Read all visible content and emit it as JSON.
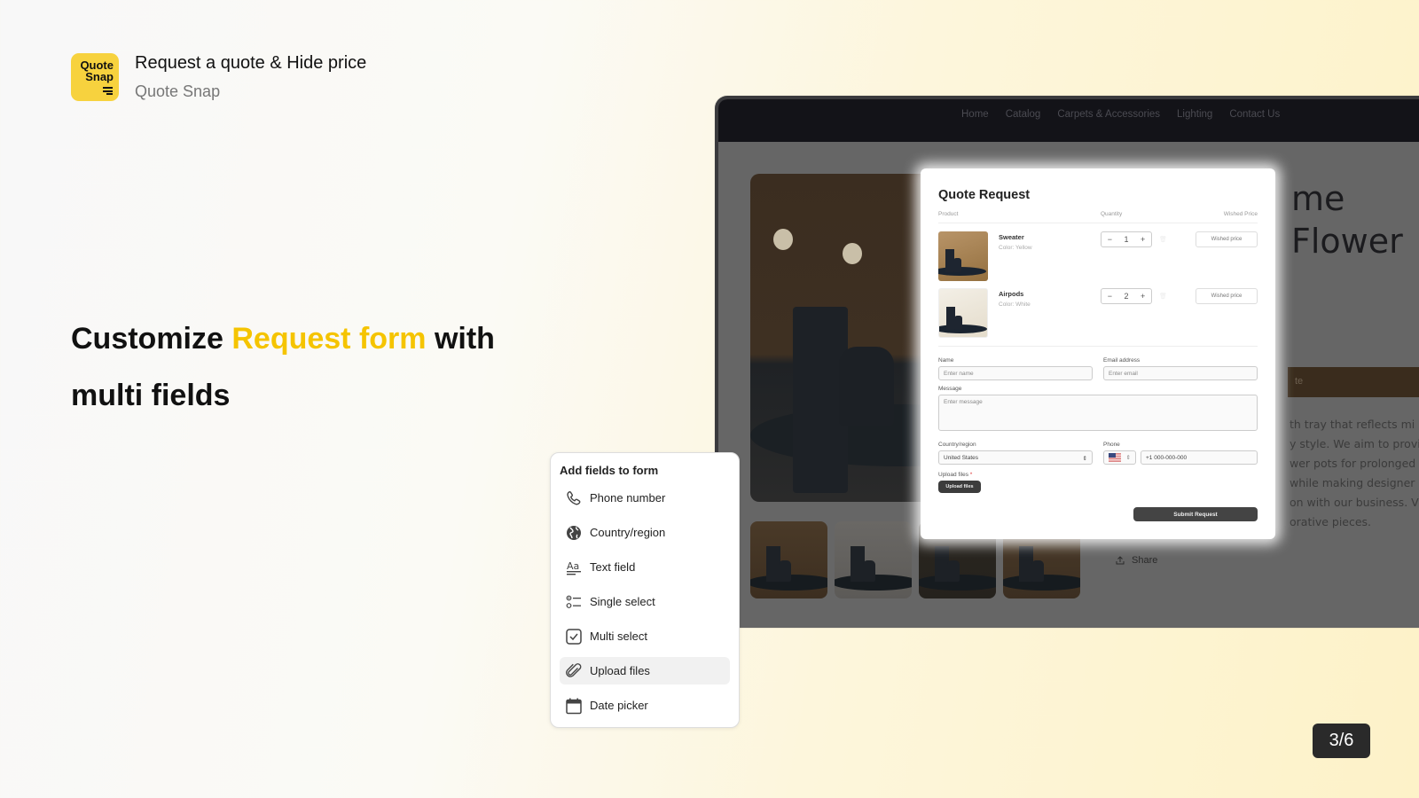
{
  "app": {
    "logo_line1": "Quote",
    "logo_line2": "Snap",
    "title": "Request a quote & Hide price",
    "developer": "Quote Snap"
  },
  "headline": {
    "part1": "Customize ",
    "highlight": "Request form",
    "part2": " with multi fields",
    "highlight_color": "#f5c400"
  },
  "store": {
    "nav": [
      "Home",
      "Catalog",
      "Carpets & Accessories",
      "Lighting",
      "Contact Us"
    ],
    "product_title_line1": "me",
    "product_title_line2": "Flower",
    "buy_button": "te",
    "description_lines": [
      "th tray that reflects mi",
      "y style. We aim to provi",
      "wer pots for prolonged",
      "while making designer",
      "on with our business. V",
      "orative pieces."
    ],
    "share_label": "Share"
  },
  "quote_form": {
    "title": "Quote Request",
    "columns": {
      "product": "Product",
      "quantity": "Quantity",
      "wished_price": "Wished Price"
    },
    "items": [
      {
        "name": "Sweater",
        "variant": "Color: Yellow",
        "quantity": "1",
        "wished_placeholder": "Wished price"
      },
      {
        "name": "Airpods",
        "variant": "Color: White",
        "quantity": "2",
        "wished_placeholder": "Wished price"
      }
    ],
    "name_label": "Name",
    "name_placeholder": "Enter name",
    "email_label": "Email address",
    "email_placeholder": "Enter email",
    "message_label": "Message",
    "message_placeholder": "Enter message",
    "country_label": "Country/region",
    "country_value": "United States",
    "phone_label": "Phone",
    "phone_value": "+1 000-000-000",
    "upload_label": "Upload files",
    "upload_required": "*",
    "upload_button": "Upload files",
    "submit_button": "Submit Request"
  },
  "fields_panel": {
    "title": "Add fields to form",
    "items": [
      {
        "label": "Phone number",
        "icon": "phone-icon"
      },
      {
        "label": "Country/region",
        "icon": "globe-icon"
      },
      {
        "label": "Text field",
        "icon": "text-field-icon"
      },
      {
        "label": "Single select",
        "icon": "single-select-icon"
      },
      {
        "label": "Multi select",
        "icon": "checkbox-icon"
      },
      {
        "label": "Upload files",
        "icon": "paperclip-icon",
        "active": true
      },
      {
        "label": "Date picker",
        "icon": "calendar-icon"
      }
    ]
  },
  "pager": "3/6"
}
